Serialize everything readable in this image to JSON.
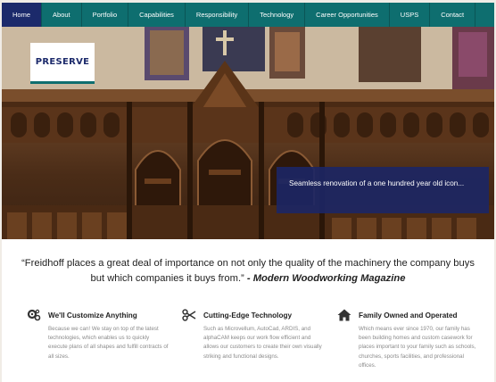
{
  "nav": {
    "items": [
      {
        "label": "Home",
        "active": true
      },
      {
        "label": "About"
      },
      {
        "label": "Portfolio"
      },
      {
        "label": "Capabilities"
      },
      {
        "label": "Responsibility"
      },
      {
        "label": "Technology"
      },
      {
        "label": "Career Opportunities"
      },
      {
        "label": "USPS"
      },
      {
        "label": "Contact"
      }
    ]
  },
  "hero": {
    "logo_text": "PRESERVE",
    "caption": "Seamless renovation of a one hundred year old icon..."
  },
  "quote": {
    "text": "“Freidhoff places a great deal of importance on not only the quality of the machinery the company buys but which companies it buys from.”",
    "source": " - Modern Woodworking Magazine"
  },
  "features": [
    {
      "icon": "gears-icon",
      "title": "We'll Customize Anything",
      "body": "Because we can! We stay on top of the latest technologies, which enables us to quickly execute plans of all shapes and fulfill contracts of all sizes."
    },
    {
      "icon": "scissors-icon",
      "title": "Cutting-Edge Technology",
      "body": "Such as Microvellum, AutoCad, ARDIS, and alphaCAM keeps our work flow efficient and allows our customers to create their own visually striking and functional designs."
    },
    {
      "icon": "home-icon",
      "title": "Family Owned and Operated",
      "body": "Which means ever since 1970, our family has been building homes and custom casework for places important to your family such as schools, churches, sports facilities, and professional offices."
    }
  ],
  "colors": {
    "nav_bg": "#0e6e6f",
    "nav_active": "#1c2a6b",
    "caption_bg": "#1c2664"
  }
}
